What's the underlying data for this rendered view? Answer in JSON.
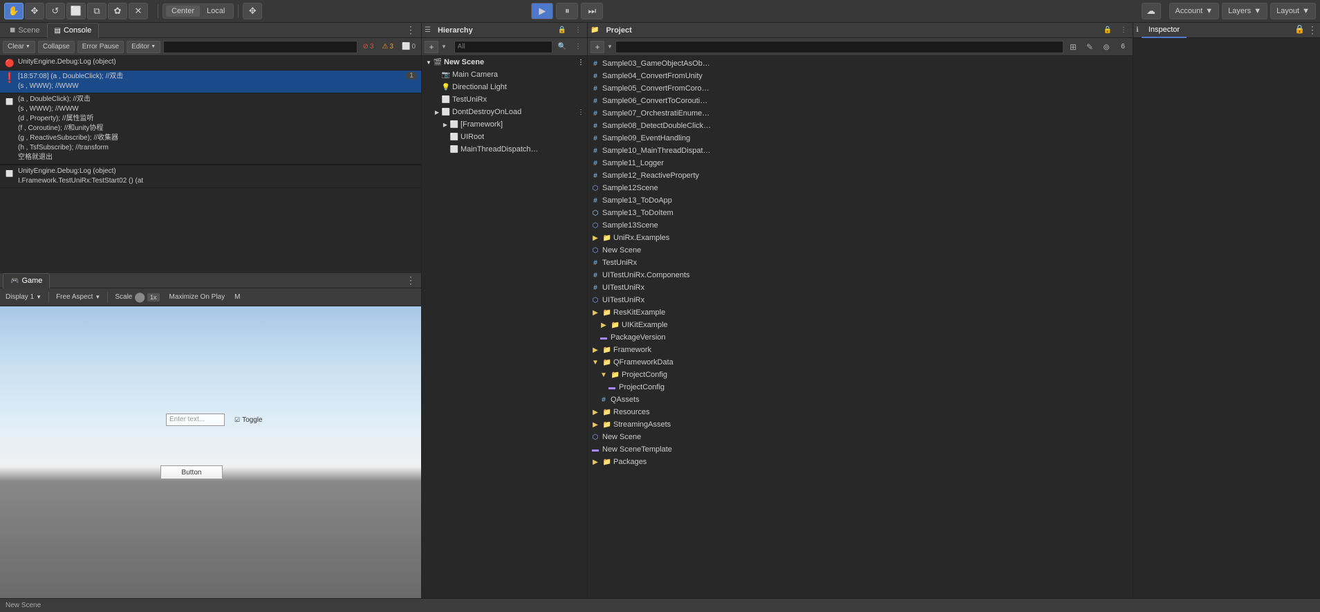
{
  "toolbar": {
    "tools": [
      "✋",
      "✥",
      "↺",
      "⬜",
      "⧉",
      "✿",
      "✕"
    ],
    "transform_center": "Center",
    "transform_local": "Local",
    "play_icon": "▶",
    "pause_icon": "⏸",
    "step_icon": "⏭",
    "cloud_icon": "☁",
    "account_label": "Account",
    "layers_label": "Layers",
    "layout_label": "Layout"
  },
  "scene_tab": "Scene",
  "console_tab": "Console",
  "console": {
    "clear_label": "Clear",
    "collapse_label": "Collapse",
    "error_pause_label": "Error Pause",
    "editor_label": "Editor",
    "search_placeholder": "",
    "badge_error_count": "3",
    "badge_warn_count": "3",
    "badge_info_count": "0",
    "items": [
      {
        "type": "error",
        "icon": "🔴",
        "text": "UnityEngine.Debug:Log (object)",
        "count": null,
        "selected": false
      },
      {
        "type": "error",
        "icon": "❗",
        "text": "[18:57:08] (a , DoubleClick);     //双击\n(s , WWW);          //WWW",
        "count": "1",
        "selected": true
      },
      {
        "type": "info",
        "icon": "ℹ",
        "text": "(a , DoubleClick);  //双击\n(s , WWW);       //WWW\n(d , Property);  //属性监听\n(f , Coroutine);  //和unity协程\n(g , ReactiveSubscribe);  //收集器\n(h , TsfSubscribe);  //transform\n空格就退出",
        "count": null,
        "selected": false
      },
      {
        "type": "info",
        "icon": "ℹ",
        "text": "UnityEngine.Debug:Log (object)\nI.Framework.TestUniRx:TestStart02 () (at",
        "count": null,
        "selected": false
      }
    ]
  },
  "game": {
    "tab_label": "Game",
    "tab_icon": "🎮",
    "display_label": "Display 1",
    "aspect_label": "Free Aspect",
    "scale_label": "Scale",
    "scale_value": "1x",
    "maximize_label": "Maximize On Play",
    "mute_label": "M",
    "scene_name": "New Scene",
    "camera_name": "Main Camera",
    "ui_input_placeholder": "Enter text...",
    "ui_toggle_label": "Toggle",
    "ui_button_label": "Button"
  },
  "hierarchy": {
    "tab_label": "Hierarchy",
    "search_placeholder": "All",
    "scene_name": "New Scene",
    "items": [
      {
        "level": 1,
        "name": "New Scene",
        "type": "scene",
        "arrow": "▼",
        "icon": "🎬"
      },
      {
        "level": 2,
        "name": "Main Camera",
        "type": "camera",
        "arrow": "",
        "icon": "📷"
      },
      {
        "level": 2,
        "name": "Directional Light",
        "type": "light",
        "arrow": "",
        "icon": "💡"
      },
      {
        "level": 2,
        "name": "TestUniRx",
        "type": "gameobj",
        "arrow": "",
        "icon": "⬜"
      },
      {
        "level": 2,
        "name": "DontDestroyOnLoad",
        "type": "gameobj",
        "arrow": "▶",
        "icon": "⬜"
      },
      {
        "level": 3,
        "name": "[Framework]",
        "type": "gameobj",
        "arrow": "▶",
        "icon": "⬜"
      },
      {
        "level": 3,
        "name": "UIRoot",
        "type": "gameobj",
        "arrow": "",
        "icon": "⬜"
      },
      {
        "level": 3,
        "name": "MainThreadDispatch",
        "type": "gameobj",
        "arrow": "",
        "icon": "⬜"
      }
    ]
  },
  "project": {
    "tab_label": "Project",
    "search_placeholder": "",
    "items": [
      {
        "level": 0,
        "name": "Sample03_GameObjectAsOb…",
        "type": "script"
      },
      {
        "level": 0,
        "name": "Sample04_ConvertFromUnity",
        "type": "script"
      },
      {
        "level": 0,
        "name": "Sample05_ConvertFromCoro…",
        "type": "script"
      },
      {
        "level": 0,
        "name": "Sample06_ConvertToCorouti…",
        "type": "script"
      },
      {
        "level": 0,
        "name": "Sample07_OrchestratiEnume…",
        "type": "script"
      },
      {
        "level": 0,
        "name": "Sample08_DetectDoubleClick…",
        "type": "script"
      },
      {
        "level": 0,
        "name": "Sample09_EventHandling",
        "type": "script"
      },
      {
        "level": 0,
        "name": "Sample10_MainThreadDispat…",
        "type": "script"
      },
      {
        "level": 0,
        "name": "Sample11_Logger",
        "type": "script"
      },
      {
        "level": 0,
        "name": "Sample12_ReactiveProperty",
        "type": "script"
      },
      {
        "level": 0,
        "name": "Sample12Scene",
        "type": "scene"
      },
      {
        "level": 0,
        "name": "Sample13_ToDoApp",
        "type": "script"
      },
      {
        "level": 0,
        "name": "Sample13_ToDoItem",
        "type": "prefab"
      },
      {
        "level": 0,
        "name": "Sample13Scene",
        "type": "scene"
      },
      {
        "level": 0,
        "name": "UniRx.Examples",
        "type": "folder"
      },
      {
        "level": 0,
        "name": "New Scene",
        "type": "scene"
      },
      {
        "level": 0,
        "name": "TestUniRx",
        "type": "script"
      },
      {
        "level": 0,
        "name": "UITestUniRx.Components",
        "type": "script"
      },
      {
        "level": 0,
        "name": "UITestUniRx",
        "type": "script"
      },
      {
        "level": 0,
        "name": "UITestUniRx",
        "type": "scene"
      },
      {
        "level": 0,
        "name": "ResKitExample",
        "type": "folder"
      },
      {
        "level": 1,
        "name": "UIKitExample",
        "type": "folder"
      },
      {
        "level": 1,
        "name": "PackageVersion",
        "type": "so"
      },
      {
        "level": 0,
        "name": "Framework",
        "type": "folder"
      },
      {
        "level": 0,
        "name": "QFrameworkData",
        "type": "folder"
      },
      {
        "level": 1,
        "name": "ProjectConfig",
        "type": "folder"
      },
      {
        "level": 2,
        "name": "ProjectConfig",
        "type": "so"
      },
      {
        "level": 1,
        "name": "QAssets",
        "type": "script"
      },
      {
        "level": 0,
        "name": "Resources",
        "type": "folder"
      },
      {
        "level": 0,
        "name": "StreamingAssets",
        "type": "folder"
      },
      {
        "level": 0,
        "name": "New Scene",
        "type": "scene"
      },
      {
        "level": 0,
        "name": "New SceneTemplate",
        "type": "so"
      },
      {
        "level": 0,
        "name": "Packages",
        "type": "folder"
      }
    ]
  },
  "inspector": {
    "tab_label": "Inspector",
    "empty_text": ""
  },
  "bottom_bar": {
    "text": "New Scene"
  }
}
